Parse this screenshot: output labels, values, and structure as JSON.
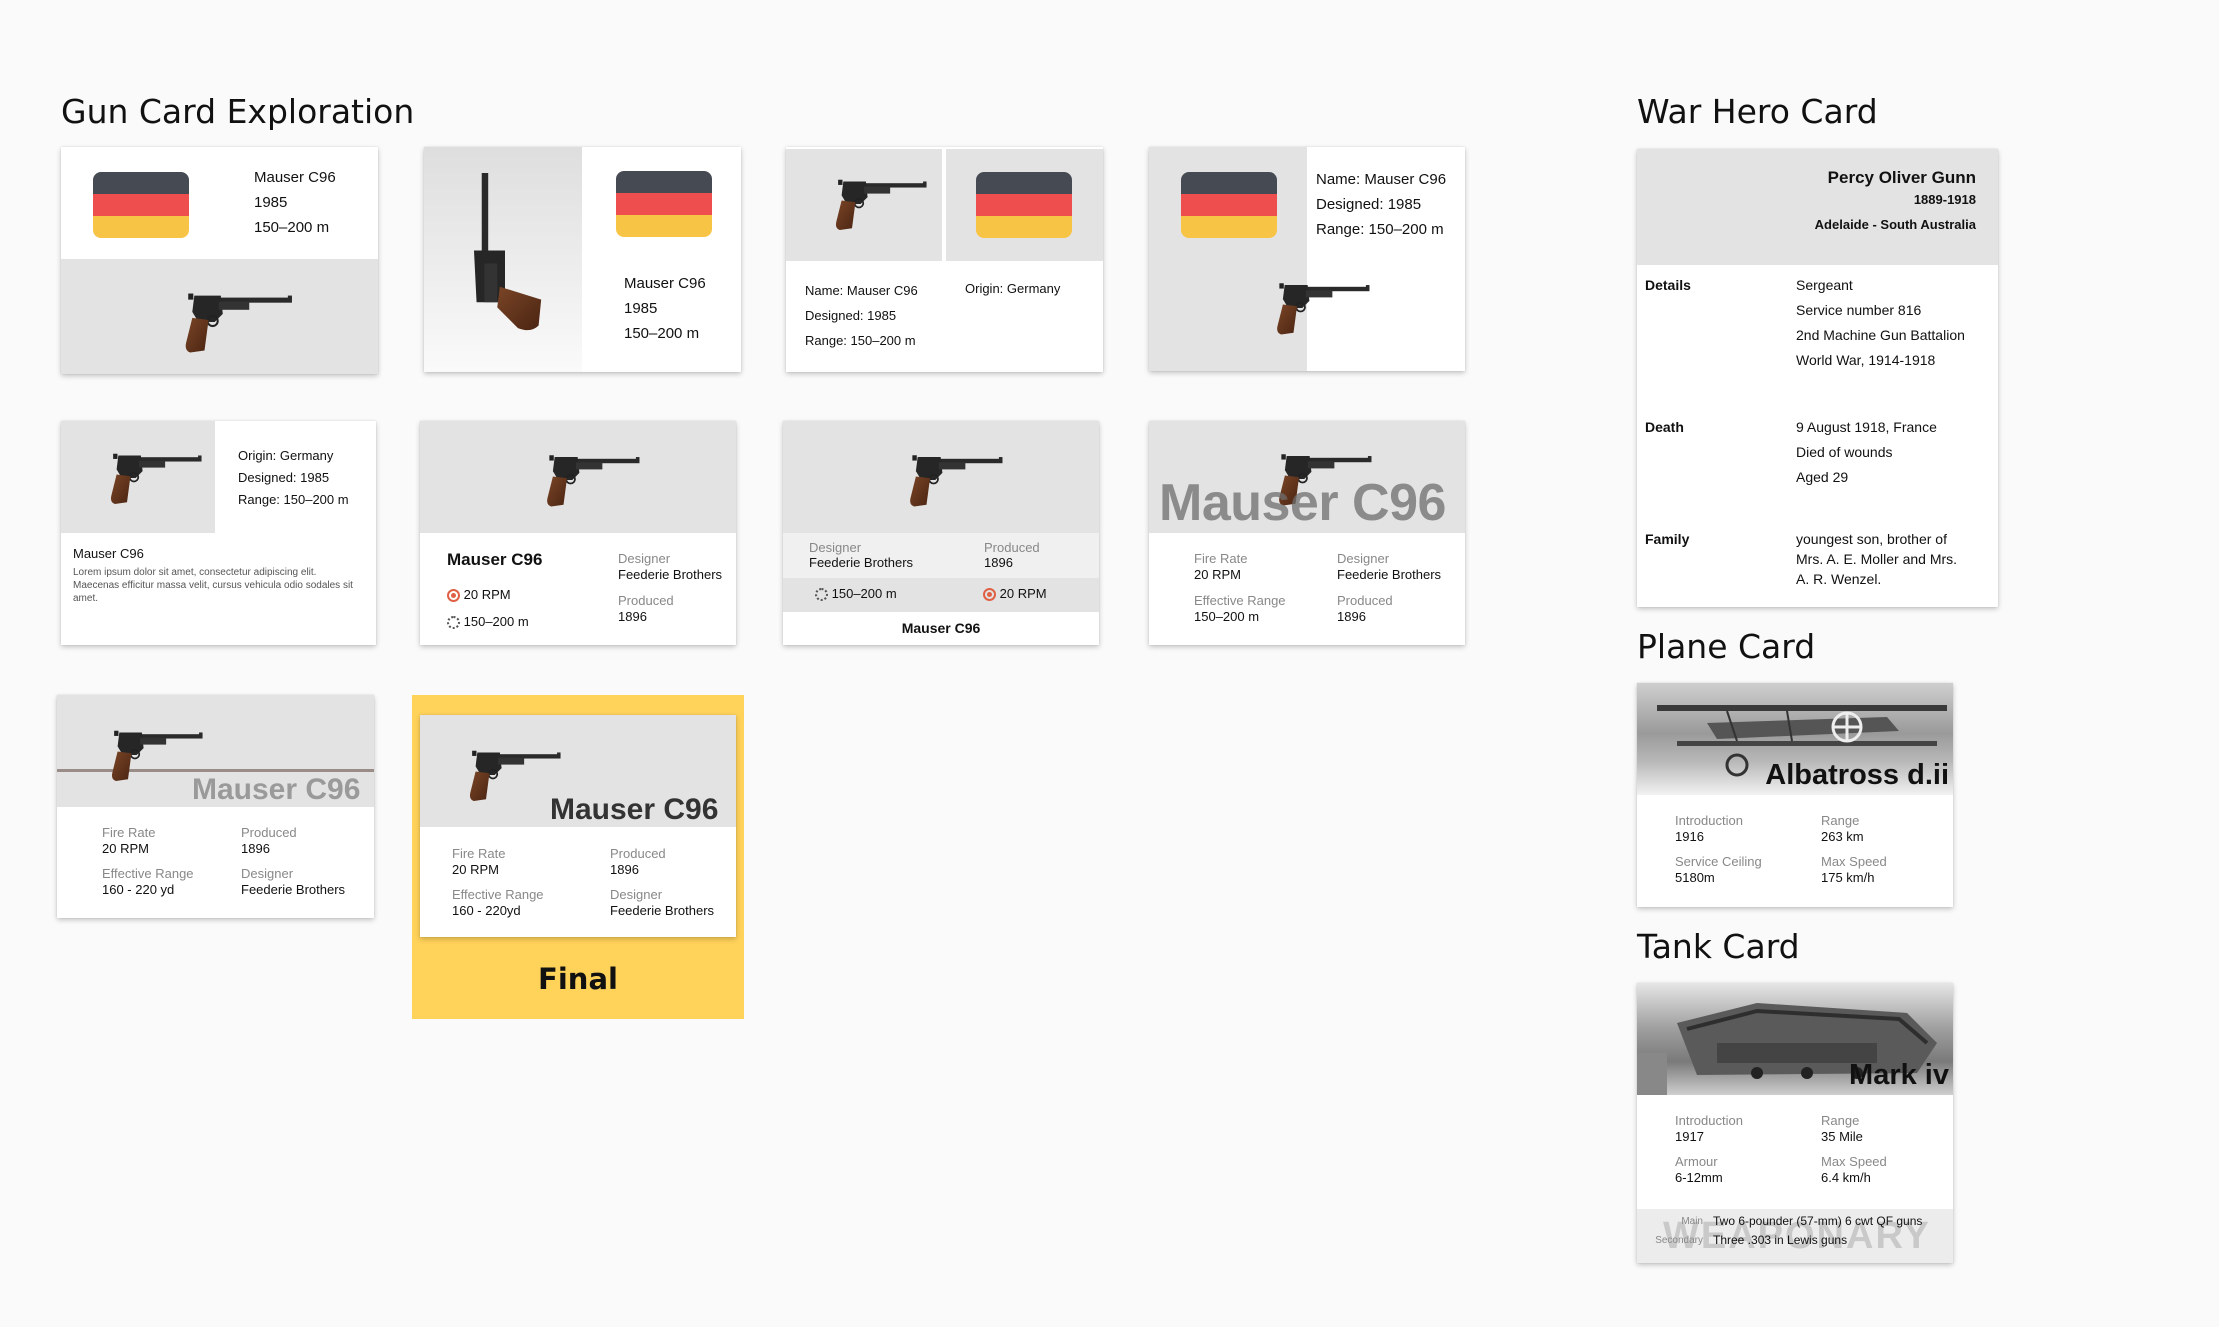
{
  "sections": {
    "gun": "Gun Card Exploration",
    "hero": "War Hero Card",
    "plane": "Plane Card",
    "tank": "Tank Card"
  },
  "colors": {
    "flag_top": "#464a52",
    "flag_mid": "#ef4e4e",
    "flag_bottom": "#f8c446",
    "final_bg": "#ffd25a",
    "accent_icon": "#e06045"
  },
  "gun": {
    "name": "Mauser C96",
    "year": "1985",
    "range": "150–200 m",
    "name_prefixed": "Name: Mauser C96",
    "designed_prefixed": "Designed: 1985",
    "range_prefixed": "Range: 150–200 m",
    "origin_prefixed": "Origin: Germany",
    "lorem": "Lorem ipsum dolor sit amet, consectetur adipiscing elit. Maecenas efficitur massa velit, cursus vehicula odio sodales sit amet.",
    "rpm": "20 RPM",
    "designer_label": "Designer",
    "designer": "Feederie Brothers",
    "produced_label": "Produced",
    "produced": "1896",
    "fire_rate_label": "Fire Rate",
    "effective_range_label": "Effective Range",
    "range_yd": "160 - 220 yd",
    "range_yd_final": "160 - 220yd",
    "final_label": "Final"
  },
  "hero": {
    "name": "Percy Oliver Gunn",
    "years": "1889-1918",
    "place": "Adelaide - South Australia",
    "rows": [
      {
        "label": "Details",
        "lines": [
          "Sergeant",
          "Service number 816",
          "2nd Machine Gun Battalion",
          "World War, 1914-1918"
        ]
      },
      {
        "label": "Death",
        "lines": [
          "9 August 1918, France",
          "Died of wounds",
          "Aged 29"
        ]
      },
      {
        "label": "Family",
        "lines": [
          "youngest son, brother of",
          "Mrs. A. E. Moller and Mrs.",
          "A. R. Wenzel."
        ]
      }
    ]
  },
  "plane": {
    "name": "Albatross d.ii",
    "stats": [
      {
        "label": "Introduction",
        "value": "1916"
      },
      {
        "label": "Range",
        "value": "263 km"
      },
      {
        "label": "Service Ceiling",
        "value": "5180m"
      },
      {
        "label": "Max Speed",
        "value": "175 km/h"
      }
    ]
  },
  "tank": {
    "name": "Mark iv",
    "stats": [
      {
        "label": "Introduction",
        "value": "1917"
      },
      {
        "label": "Range",
        "value": "35 Mile"
      },
      {
        "label": "Armour",
        "value": "6-12mm"
      },
      {
        "label": "Max Speed",
        "value": "6.4 km/h"
      }
    ],
    "watermark": "WEAPONARY",
    "weapons": [
      {
        "label": "Main",
        "value": "Two 6-pounder (57-mm) 6 cwt QF guns"
      },
      {
        "label": "Secondary",
        "value": "Three .303 in Lewis guns"
      }
    ]
  }
}
